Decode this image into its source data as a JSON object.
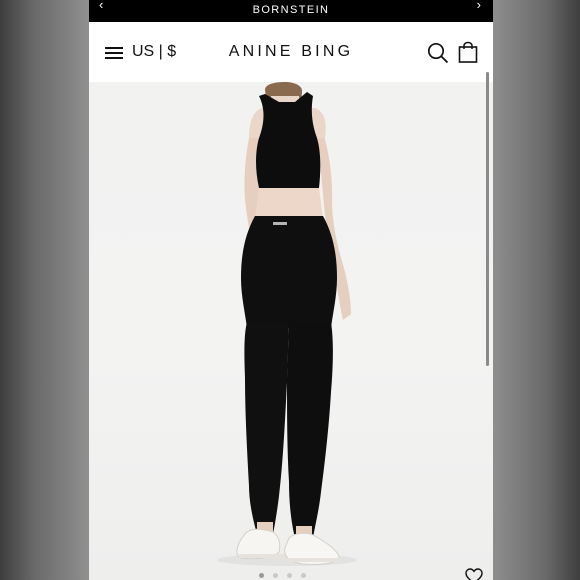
{
  "promo_bar": {
    "text": "BORNSTEIN",
    "prev_icon": "chevron-left-icon",
    "next_icon": "chevron-right-icon"
  },
  "header": {
    "menu_icon": "hamburger-menu-icon",
    "currency_label": "US | $",
    "logo": "ANINE BING",
    "search_icon": "search-icon",
    "bag_icon": "shopping-bag-icon"
  },
  "product_image": {
    "image_indicator_count": 4,
    "active_index": 0,
    "wishlist_icon": "heart-icon"
  },
  "colors": {
    "promo_bar_bg": "#000000",
    "header_bg": "#ffffff",
    "text": "#111111",
    "hero_bg": "#f2f2f1"
  }
}
